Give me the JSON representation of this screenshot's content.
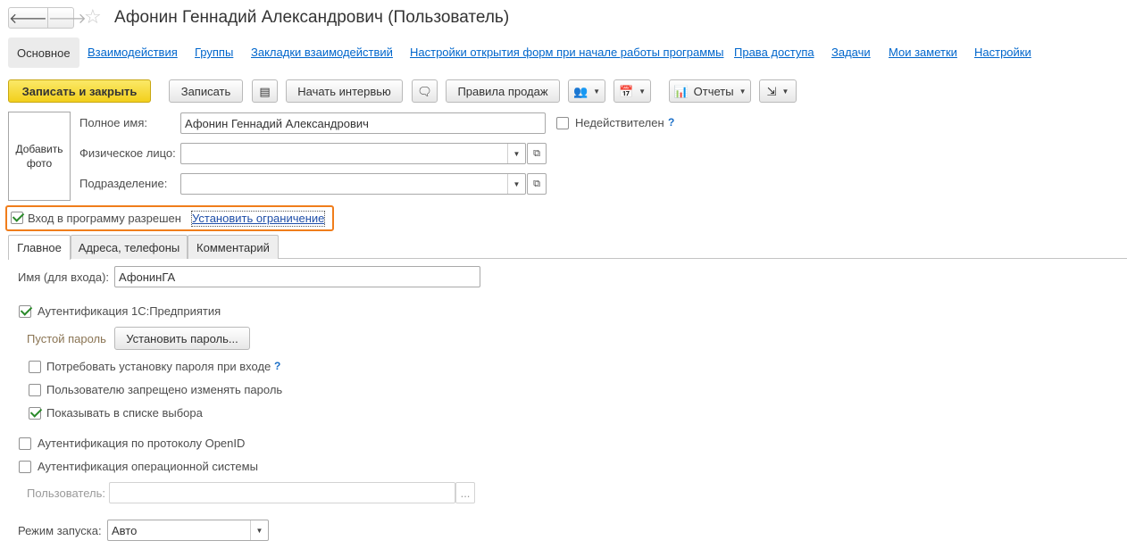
{
  "window": {
    "title": "Афонин Геннадий Александрович (Пользователь)",
    "back_glyph": "🡐",
    "forward_glyph": "🡒",
    "star_glyph": "☆"
  },
  "sections": {
    "active": "Основное",
    "links": [
      "Взаимодействия",
      "Группы",
      "Закладки взаимодействий",
      "Настройки открытия форм при начале работы программы",
      "Права доступа",
      "Задачи",
      "Мои заметки",
      "Настройки"
    ]
  },
  "toolbar": {
    "save_close": "Записать и закрыть",
    "save": "Записать",
    "start_interview": "Начать интервью",
    "sales_rules": "Правила продаж",
    "reports": "Отчеты",
    "caret": "▼",
    "icons": {
      "list": "▤",
      "chat": "🗨",
      "users": "👥",
      "calendar": "📅",
      "report": "📊",
      "export": "⇲"
    }
  },
  "photo": {
    "label_line1": "Добавить",
    "label_line2": "фото"
  },
  "fields": {
    "full_name_label": "Полное имя:",
    "full_name_value": "Афонин Геннадий Александрович",
    "individual_label": "Физическое лицо:",
    "individual_value": "",
    "department_label": "Подразделение:",
    "department_value": "",
    "invalid_label": "Недействителен",
    "help_mark": "?",
    "open_glyph": "⧉"
  },
  "login": {
    "allowed_label": "Вход в программу разрешен",
    "set_restriction": "Установить ограничение"
  },
  "tabs": [
    "Главное",
    "Адреса, телефоны",
    "Комментарий"
  ],
  "main_tab": {
    "login_name_label": "Имя (для входа):",
    "login_name_value": "АфонинГА",
    "auth_1c_label": "Аутентификация 1С:Предприятия",
    "empty_password": "Пустой пароль",
    "set_password": "Установить пароль...",
    "require_password_label": "Потребовать установку пароля при входе",
    "forbid_change_label": "Пользователю запрещено изменять пароль",
    "show_in_list_label": "Показывать в списке выбора",
    "openid_label": "Аутентификация по протоколу OpenID",
    "os_auth_label": "Аутентификация операционной системы",
    "os_user_label": "Пользователь:",
    "os_user_value": "",
    "os_user_btn": "...",
    "launch_mode_label": "Режим запуска:",
    "launch_mode_value": "Авто"
  }
}
